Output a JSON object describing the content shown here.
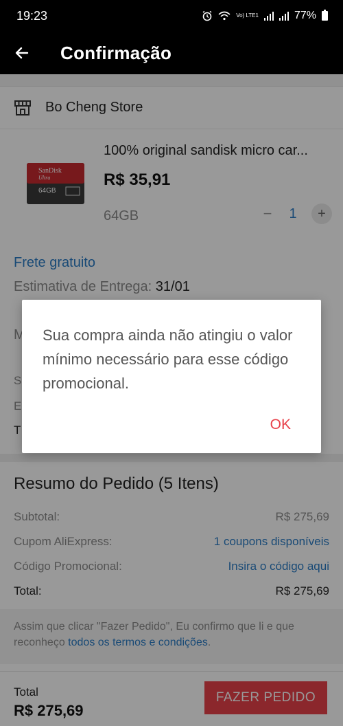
{
  "status_bar": {
    "time": "19:23",
    "network": "Vo) LTE1",
    "battery": "77%"
  },
  "app_bar": {
    "title": "Confirmação",
    "back_icon": "arrow-back-icon"
  },
  "store": {
    "icon": "store-icon",
    "name": "Bo Cheng  Store"
  },
  "product": {
    "title": "100% original sandisk micro car...",
    "price": "R$ 35,91",
    "variant": "64GB",
    "qty_minus": "−",
    "quantity": "1",
    "qty_plus": "+",
    "thumb_brand": "SanDisk",
    "thumb_line": "Ultra",
    "thumb_capacity": "64GB"
  },
  "shipping": {
    "free_label": "Frete gratuito",
    "delivery_label": "Estimativa de Entrega: ",
    "delivery_date": "31/01"
  },
  "summary": {
    "title": "Resumo do Pedido (5 Itens)",
    "rows": [
      {
        "label": "Subtotal:",
        "value": "R$ 275,69"
      },
      {
        "label": "Cupom AliExpress:",
        "value": "1 coupons disponíveis"
      },
      {
        "label": "Código Promocional:",
        "value": "Insira o código aqui"
      },
      {
        "label": "Total:",
        "value": "R$ 275,69"
      }
    ]
  },
  "terms": {
    "text": "Assim que clicar \"Fazer Pedido\", Eu confirmo que li e que reconheço ",
    "link": "todos os termos e condições",
    "end": "."
  },
  "bottom": {
    "total_label": "Total",
    "total_value": "R$ 275,69",
    "order_button": "FAZER PEDIDO"
  },
  "dialog": {
    "message": "Sua compra ainda não atingiu o valor mínimo necessário para esse código promocional.",
    "ok": "OK"
  },
  "colors": {
    "accent_red": "#e8414a",
    "link_blue": "#2b7cc5"
  }
}
